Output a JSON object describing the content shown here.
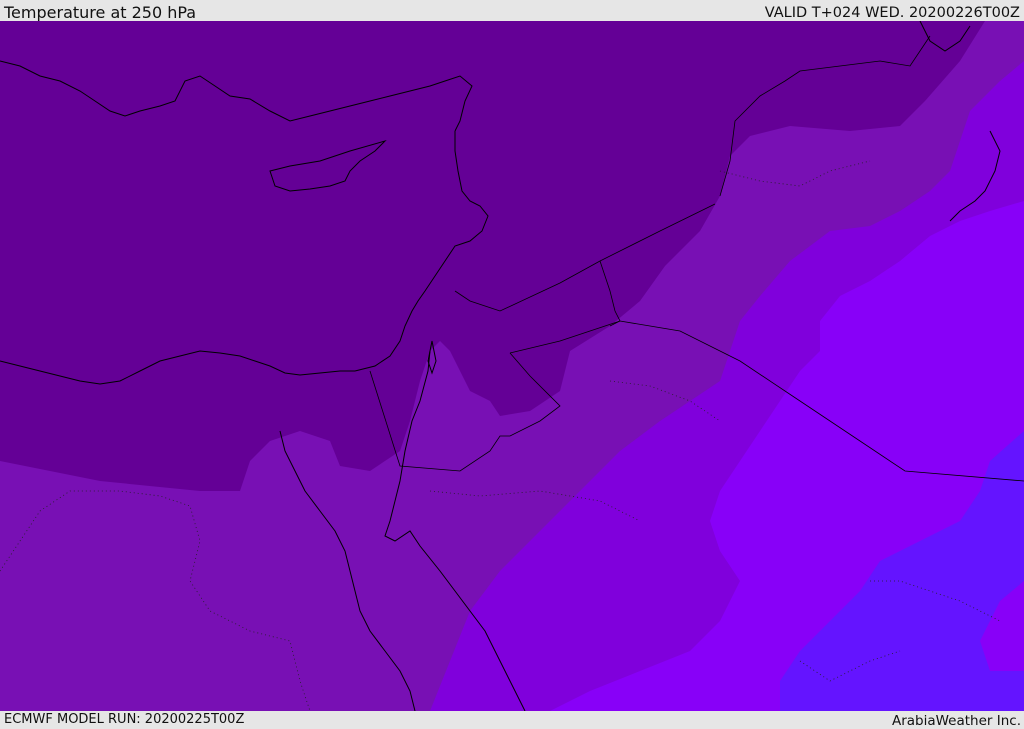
{
  "header": {
    "title": "Temperature at 250 hPa",
    "valid": "VALID T+024 WED. 20200226T00Z"
  },
  "footer": {
    "model_run": "ECMWF MODEL RUN: 20200225T00Z",
    "credit": "ArabiaWeather Inc."
  },
  "map": {
    "colors": {
      "coldest": "#640096",
      "cold": "#7810b4",
      "cool": "#8000dc",
      "mild": "#8800f8",
      "warmer": "#6414ff",
      "coastline": "#000000"
    }
  }
}
